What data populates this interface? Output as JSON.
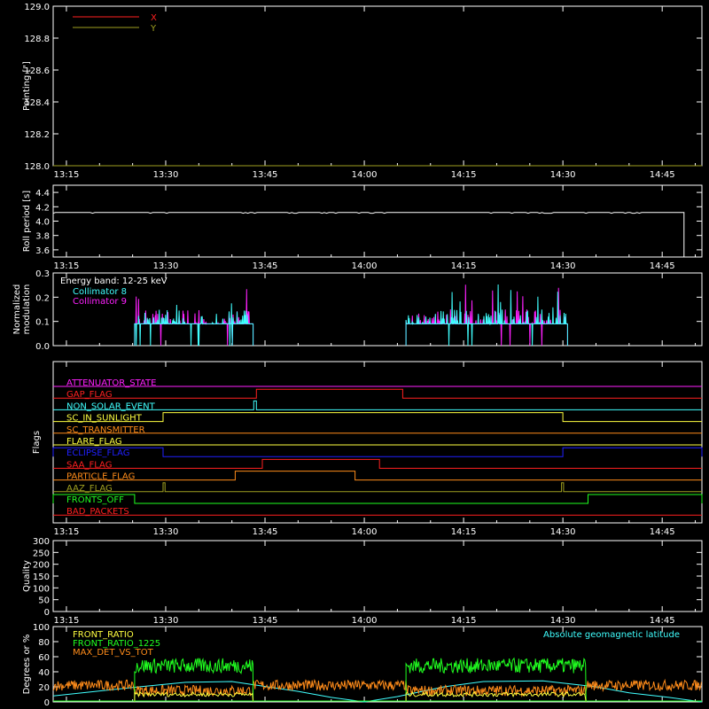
{
  "time_axis": {
    "ticks": [
      "13:15",
      "13:30",
      "13:45",
      "14:00",
      "14:15",
      "14:30",
      "14:45"
    ],
    "range_minutes": [
      13.0,
      111.0
    ],
    "tick_minutes": [
      15,
      30,
      45,
      60,
      75,
      90,
      105
    ]
  },
  "colors": {
    "background": "#000000",
    "axes": "#ffffff",
    "red": "#ff2020",
    "yellow": "#ffff40",
    "cyan": "#40ffff",
    "magenta": "#ff20ff",
    "green": "#20ff20",
    "orange": "#ff8c1a",
    "olive": "#a0a020",
    "blue": "#2020ff",
    "pink": "#ff40ff",
    "white": "#ffffff"
  },
  "chart_data": [
    {
      "id": "pointing",
      "type": "line",
      "ylabel": "Pointing [\"]",
      "ylim": [
        128.0,
        129.0
      ],
      "yticks": [
        "128.0",
        "128.2",
        "128.4",
        "128.6",
        "128.8",
        "129.0"
      ],
      "yvalues": [
        128.0,
        128.2,
        128.4,
        128.6,
        128.8,
        129.0
      ],
      "series": [
        {
          "name": "X",
          "color": "#ff2020",
          "x": [],
          "y": []
        },
        {
          "name": "Y",
          "color": "#a0a020",
          "x": [
            13,
            111
          ],
          "y": [
            128.0,
            128.0
          ]
        }
      ]
    },
    {
      "id": "roll",
      "type": "line",
      "ylabel": "Roll period [s]",
      "ylim": [
        3.5,
        4.5
      ],
      "yticks": [
        "3.6",
        "3.8",
        "4.0",
        "4.2",
        "4.4"
      ],
      "yvalues": [
        3.6,
        3.8,
        4.0,
        4.2,
        4.4
      ],
      "series": [
        {
          "name": "",
          "color": "#ffffff",
          "x": [
            13,
            108.3,
            108.3
          ],
          "y": [
            4.12,
            4.12,
            3.5
          ]
        }
      ]
    },
    {
      "id": "modulation",
      "type": "line",
      "ylabel": [
        "Normalized",
        "modulation"
      ],
      "ylim": [
        0.0,
        0.3
      ],
      "yticks": [
        "0.0",
        "0.1",
        "0.2",
        "0.3"
      ],
      "yvalues": [
        0.0,
        0.1,
        0.2,
        0.3
      ],
      "annotation": "Energy band: 12-25 keV",
      "series": [
        {
          "name": "Collimator 8",
          "color": "#40ffff",
          "segments": [
            [
              25.3,
              43.2
            ],
            [
              66.3,
              90.7
            ]
          ],
          "base": 0.09
        },
        {
          "name": "Collimator 9",
          "color": "#ff20ff",
          "segments": [
            [
              25.3,
              43.2
            ],
            [
              66.3,
              90.7
            ]
          ],
          "base": 0.09
        }
      ]
    },
    {
      "id": "flags",
      "type": "line",
      "ylabel": "Flags",
      "flags": [
        {
          "name": "ATTENUATOR_STATE",
          "color": "#ff20ff",
          "high": []
        },
        {
          "name": "GAP_FLAG",
          "color": "#ff2020",
          "high": [
            [
              43.7,
              65.8
            ]
          ]
        },
        {
          "name": "NON_SOLAR_EVENT",
          "color": "#40ffff",
          "high": [
            [
              43.3,
              43.7
            ]
          ]
        },
        {
          "name": "SC_IN_SUNLIGHT",
          "color": "#ffff40",
          "high": [
            [
              29.6,
              90.0
            ]
          ]
        },
        {
          "name": "SC_TRANSMITTER",
          "color": "#ff8c1a",
          "high": []
        },
        {
          "name": "FLARE_FLAG",
          "color": "#ffff40",
          "high": []
        },
        {
          "name": "ECLIPSE_FLAG",
          "color": "#2020ff",
          "high": [
            [
              13,
              29.6
            ],
            [
              90.0,
              111
            ]
          ]
        },
        {
          "name": "SAA_FLAG",
          "color": "#ff2020",
          "high": [
            [
              44.6,
              62.3
            ]
          ]
        },
        {
          "name": "PARTICLE_FLAG",
          "color": "#ff8c1a",
          "high": [
            [
              40.5,
              58.6
            ]
          ]
        },
        {
          "name": "AAZ_FLAG",
          "color": "#a0a020",
          "high": [
            [
              29.6,
              29.9
            ],
            [
              89.8,
              90.1
            ]
          ]
        },
        {
          "name": "FRONTS_OFF",
          "color": "#20ff20",
          "high": [
            [
              13,
              25.3
            ],
            [
              93.8,
              111
            ]
          ]
        },
        {
          "name": "BAD_PACKETS",
          "color": "#ff2020",
          "high": []
        }
      ]
    },
    {
      "id": "quality",
      "type": "line",
      "ylabel": "Quality",
      "ylim": [
        0,
        300
      ],
      "yticks": [
        "0",
        "50",
        "100",
        "150",
        "200",
        "250",
        "300"
      ],
      "yvalues": [
        0,
        50,
        100,
        150,
        200,
        250,
        300
      ],
      "series": []
    },
    {
      "id": "ratios",
      "type": "line",
      "ylabel": "Degrees or %",
      "ylim": [
        0,
        100
      ],
      "yticks": [
        "0",
        "20",
        "40",
        "60",
        "80",
        "100"
      ],
      "yvalues": [
        0,
        20,
        40,
        60,
        80,
        100
      ],
      "series": [
        {
          "name": "FRONT_RATIO",
          "color": "#ffff40",
          "segments": [
            [
              25.3,
              43.2
            ],
            [
              66.3,
              93.5
            ]
          ],
          "base": 10
        },
        {
          "name": "FRONT_RATIO_1225",
          "color": "#20ff20",
          "segments": [
            [
              25.3,
              43.2
            ],
            [
              66.3,
              93.5
            ]
          ],
          "base": 48
        },
        {
          "name": "MAX_DET_VS_TOT",
          "color": "#ff8c1a",
          "segments": [
            [
              13,
              111
            ]
          ],
          "base": 22
        },
        {
          "name": "Absolute geomagnetic latitude",
          "color": "#40ffff",
          "x": [
            13,
            26,
            33,
            40,
            50,
            55,
            60,
            65,
            72,
            78,
            87,
            95,
            100,
            106,
            111
          ],
          "y": [
            8,
            20,
            26,
            27,
            14,
            6,
            0,
            7,
            20,
            27,
            28,
            20,
            12,
            6,
            0
          ]
        }
      ]
    }
  ]
}
